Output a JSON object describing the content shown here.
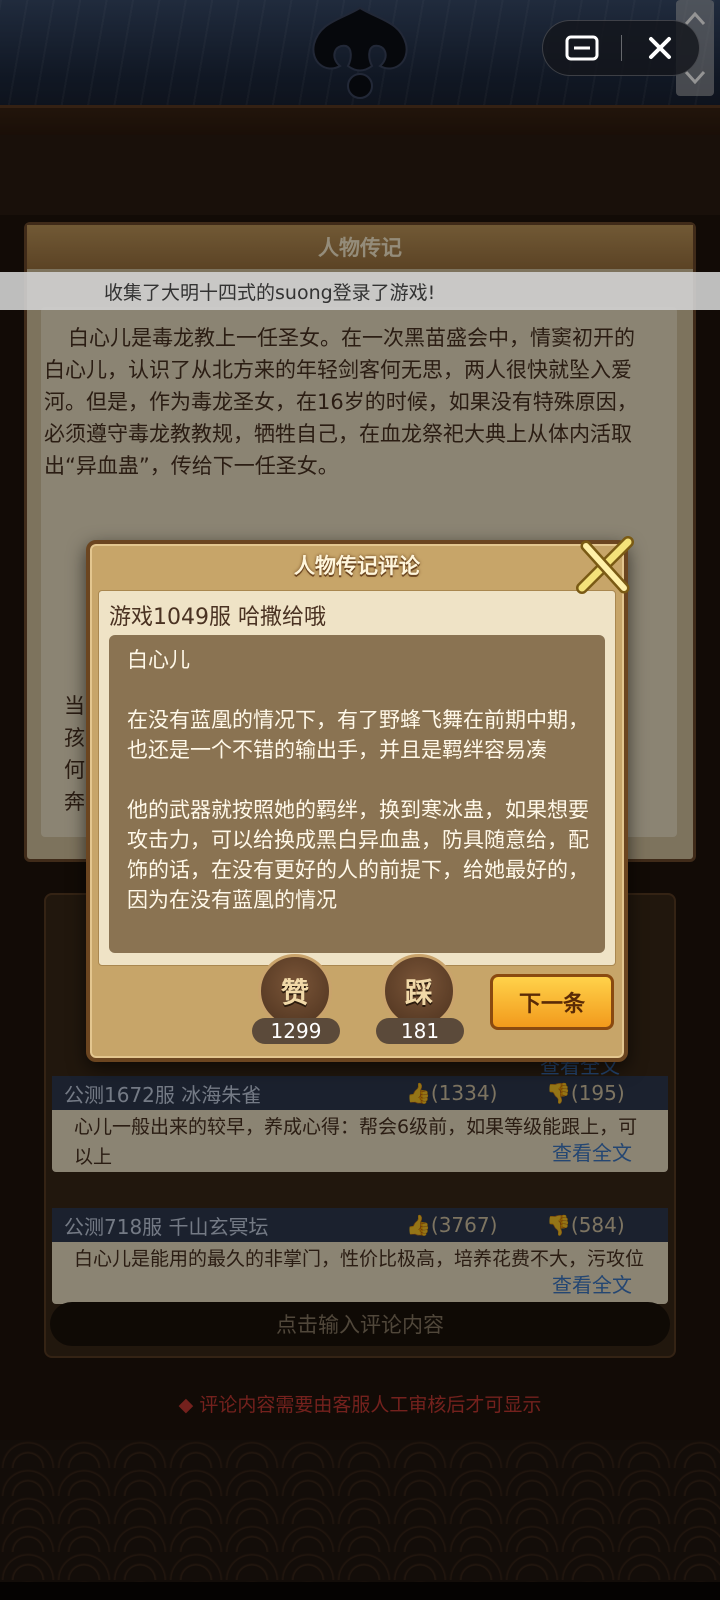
{
  "overlay": {
    "menu_icon": "menu-icon",
    "close_icon": "close-icon"
  },
  "broadcast": {
    "text": "收集了大明十四式的suong登录了游戏!"
  },
  "background": {
    "bio_title": "人物传记",
    "bio_text": "白心儿是毒龙教上一任圣女。在一次黑苗盛会中，情窦初开的白心儿，认识了从北方来的年轻剑客何无思，两人很快就坠入爱河。但是，作为毒龙圣女，在16岁的时候，如果没有特殊原因，必须遵守毒龙教教规，牺牲自己，在血龙祭祀大典上从体内活取出“异血蛊”，传给下一任圣女。",
    "bio_partial": "当孩何奔",
    "comments": [
      {
        "server": "公测1672服 冰海朱雀",
        "likes": "(1334)",
        "dislikes": "(195)",
        "body": "心儿一般出来的较早，养成心得：帮会6级前，如果等级能跟上，可以上",
        "more": "查看全文"
      },
      {
        "server": "公测718服   千山玄冥坛",
        "likes": "(3767)",
        "dislikes": "(584)",
        "body": "白心儿是能用的最久的非掌门，性价比极高，培养花费不大，污攻位",
        "more": "查看全文"
      }
    ],
    "partial_more": "查看全文",
    "input_placeholder": "点击输入评论内容",
    "notice": "◆ 评论内容需要由客服人工审核后才可显示"
  },
  "modal": {
    "title": "人物传记评论",
    "author": "游戏1049服 哈撒给哦",
    "content": "白心儿\n\n在没有蓝凰的情况下，有了野蜂飞舞在前期中期，也还是一个不错的输出手，并且是羁绊容易凑\n\n他的武器就按照她的羁绊，换到寒冰蛊，如果想要攻击力，可以给换成黑白异血蛊，防具随意给，配饰的话，在没有更好的人的前提下，给她最好的，因为在没有蓝凰的情况",
    "like_label": "赞",
    "like_count": "1299",
    "dislike_label": "踩",
    "dislike_count": "181",
    "next_label": "下一条"
  }
}
